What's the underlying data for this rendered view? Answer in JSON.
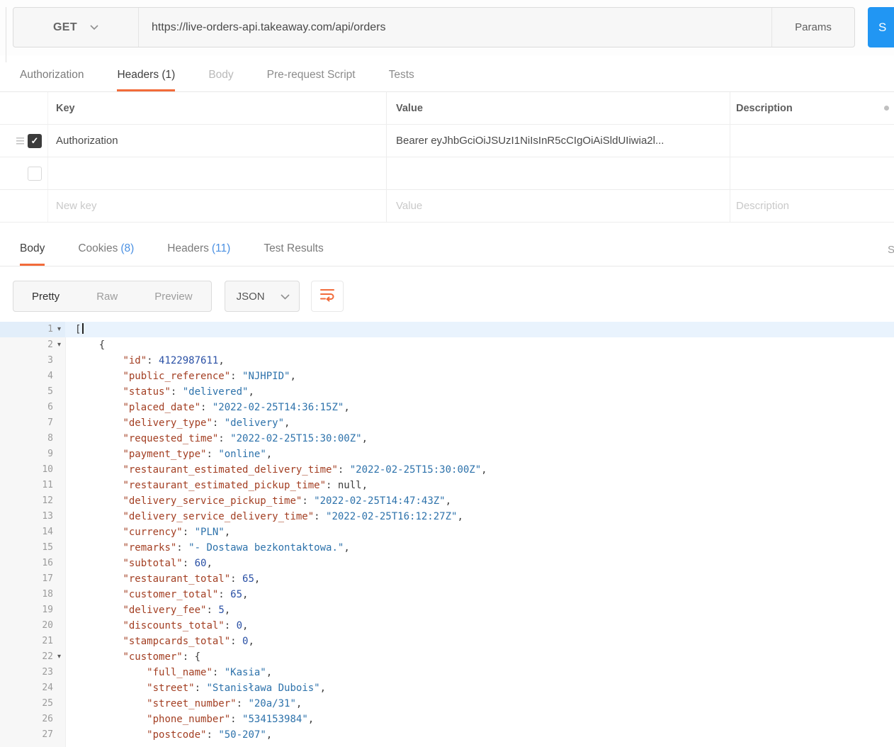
{
  "request": {
    "method": "GET",
    "url": "https://live-orders-api.takeaway.com/api/orders",
    "params_label": "Params",
    "send_label": "S"
  },
  "request_tabs": {
    "authorization": "Authorization",
    "headers": "Headers (1)",
    "body": "Body",
    "prerequest": "Pre-request Script",
    "tests": "Tests"
  },
  "headers_table": {
    "columns": {
      "key": "Key",
      "value": "Value",
      "description": "Description"
    },
    "rows": [
      {
        "key": "Authorization",
        "value": "Bearer eyJhbGciOiJSUzI1NiIsInR5cCIgOiAiSldUIiwia2l...",
        "checked": true
      }
    ],
    "placeholders": {
      "key": "New key",
      "value": "Value",
      "description": "Description"
    }
  },
  "response_tabs": {
    "body": "Body",
    "cookies_label": "Cookies",
    "cookies_count": "(8)",
    "headers_label": "Headers",
    "headers_count": "(11)",
    "test_results": "Test Results",
    "status_cut": "S"
  },
  "response_toolbar": {
    "pretty": "Pretty",
    "raw": "Raw",
    "preview": "Preview",
    "format": "JSON"
  },
  "colors": {
    "accent_orange": "#f26b3a",
    "send_blue": "#2196f3",
    "count_blue": "#4a90e2",
    "json_key": "#a33f23",
    "json_string": "#2d72ab",
    "json_number": "#2a50a5"
  },
  "code": {
    "language": "JSON",
    "lines": [
      {
        "num": 1,
        "fold": true,
        "highlight": true,
        "cursor": true,
        "tokens": [
          [
            "p",
            "["
          ]
        ]
      },
      {
        "num": 2,
        "fold": true,
        "tokens": [
          [
            "p",
            "    {"
          ]
        ]
      },
      {
        "num": 3,
        "tokens": [
          [
            "p",
            "        "
          ],
          [
            "k",
            "\"id\""
          ],
          [
            "p",
            ": "
          ],
          [
            "n",
            "4122987611"
          ],
          [
            "p",
            ","
          ]
        ]
      },
      {
        "num": 4,
        "tokens": [
          [
            "p",
            "        "
          ],
          [
            "k",
            "\"public_reference\""
          ],
          [
            "p",
            ": "
          ],
          [
            "s",
            "\"NJHPID\""
          ],
          [
            "p",
            ","
          ]
        ]
      },
      {
        "num": 5,
        "tokens": [
          [
            "p",
            "        "
          ],
          [
            "k",
            "\"status\""
          ],
          [
            "p",
            ": "
          ],
          [
            "s",
            "\"delivered\""
          ],
          [
            "p",
            ","
          ]
        ]
      },
      {
        "num": 6,
        "tokens": [
          [
            "p",
            "        "
          ],
          [
            "k",
            "\"placed_date\""
          ],
          [
            "p",
            ": "
          ],
          [
            "s",
            "\"2022-02-25T14:36:15Z\""
          ],
          [
            "p",
            ","
          ]
        ]
      },
      {
        "num": 7,
        "tokens": [
          [
            "p",
            "        "
          ],
          [
            "k",
            "\"delivery_type\""
          ],
          [
            "p",
            ": "
          ],
          [
            "s",
            "\"delivery\""
          ],
          [
            "p",
            ","
          ]
        ]
      },
      {
        "num": 8,
        "tokens": [
          [
            "p",
            "        "
          ],
          [
            "k",
            "\"requested_time\""
          ],
          [
            "p",
            ": "
          ],
          [
            "s",
            "\"2022-02-25T15:30:00Z\""
          ],
          [
            "p",
            ","
          ]
        ]
      },
      {
        "num": 9,
        "tokens": [
          [
            "p",
            "        "
          ],
          [
            "k",
            "\"payment_type\""
          ],
          [
            "p",
            ": "
          ],
          [
            "s",
            "\"online\""
          ],
          [
            "p",
            ","
          ]
        ]
      },
      {
        "num": 10,
        "tokens": [
          [
            "p",
            "        "
          ],
          [
            "k",
            "\"restaurant_estimated_delivery_time\""
          ],
          [
            "p",
            ": "
          ],
          [
            "s",
            "\"2022-02-25T15:30:00Z\""
          ],
          [
            "p",
            ","
          ]
        ]
      },
      {
        "num": 11,
        "tokens": [
          [
            "p",
            "        "
          ],
          [
            "k",
            "\"restaurant_estimated_pickup_time\""
          ],
          [
            "p",
            ": "
          ],
          [
            "u",
            "null"
          ],
          [
            "p",
            ","
          ]
        ]
      },
      {
        "num": 12,
        "tokens": [
          [
            "p",
            "        "
          ],
          [
            "k",
            "\"delivery_service_pickup_time\""
          ],
          [
            "p",
            ": "
          ],
          [
            "s",
            "\"2022-02-25T14:47:43Z\""
          ],
          [
            "p",
            ","
          ]
        ]
      },
      {
        "num": 13,
        "tokens": [
          [
            "p",
            "        "
          ],
          [
            "k",
            "\"delivery_service_delivery_time\""
          ],
          [
            "p",
            ": "
          ],
          [
            "s",
            "\"2022-02-25T16:12:27Z\""
          ],
          [
            "p",
            ","
          ]
        ]
      },
      {
        "num": 14,
        "tokens": [
          [
            "p",
            "        "
          ],
          [
            "k",
            "\"currency\""
          ],
          [
            "p",
            ": "
          ],
          [
            "s",
            "\"PLN\""
          ],
          [
            "p",
            ","
          ]
        ]
      },
      {
        "num": 15,
        "tokens": [
          [
            "p",
            "        "
          ],
          [
            "k",
            "\"remarks\""
          ],
          [
            "p",
            ": "
          ],
          [
            "s",
            "\"- Dostawa bezkontaktowa.\""
          ],
          [
            "p",
            ","
          ]
        ]
      },
      {
        "num": 16,
        "tokens": [
          [
            "p",
            "        "
          ],
          [
            "k",
            "\"subtotal\""
          ],
          [
            "p",
            ": "
          ],
          [
            "n",
            "60"
          ],
          [
            "p",
            ","
          ]
        ]
      },
      {
        "num": 17,
        "tokens": [
          [
            "p",
            "        "
          ],
          [
            "k",
            "\"restaurant_total\""
          ],
          [
            "p",
            ": "
          ],
          [
            "n",
            "65"
          ],
          [
            "p",
            ","
          ]
        ]
      },
      {
        "num": 18,
        "tokens": [
          [
            "p",
            "        "
          ],
          [
            "k",
            "\"customer_total\""
          ],
          [
            "p",
            ": "
          ],
          [
            "n",
            "65"
          ],
          [
            "p",
            ","
          ]
        ]
      },
      {
        "num": 19,
        "tokens": [
          [
            "p",
            "        "
          ],
          [
            "k",
            "\"delivery_fee\""
          ],
          [
            "p",
            ": "
          ],
          [
            "n",
            "5"
          ],
          [
            "p",
            ","
          ]
        ]
      },
      {
        "num": 20,
        "tokens": [
          [
            "p",
            "        "
          ],
          [
            "k",
            "\"discounts_total\""
          ],
          [
            "p",
            ": "
          ],
          [
            "n",
            "0"
          ],
          [
            "p",
            ","
          ]
        ]
      },
      {
        "num": 21,
        "tokens": [
          [
            "p",
            "        "
          ],
          [
            "k",
            "\"stampcards_total\""
          ],
          [
            "p",
            ": "
          ],
          [
            "n",
            "0"
          ],
          [
            "p",
            ","
          ]
        ]
      },
      {
        "num": 22,
        "fold": true,
        "tokens": [
          [
            "p",
            "        "
          ],
          [
            "k",
            "\"customer\""
          ],
          [
            "p",
            ": {"
          ]
        ]
      },
      {
        "num": 23,
        "tokens": [
          [
            "p",
            "            "
          ],
          [
            "k",
            "\"full_name\""
          ],
          [
            "p",
            ": "
          ],
          [
            "s",
            "\"Kasia\""
          ],
          [
            "p",
            ","
          ]
        ]
      },
      {
        "num": 24,
        "tokens": [
          [
            "p",
            "            "
          ],
          [
            "k",
            "\"street\""
          ],
          [
            "p",
            ": "
          ],
          [
            "s",
            "\"Stanisława Dubois\""
          ],
          [
            "p",
            ","
          ]
        ]
      },
      {
        "num": 25,
        "tokens": [
          [
            "p",
            "            "
          ],
          [
            "k",
            "\"street_number\""
          ],
          [
            "p",
            ": "
          ],
          [
            "s",
            "\"20a/31\""
          ],
          [
            "p",
            ","
          ]
        ]
      },
      {
        "num": 26,
        "tokens": [
          [
            "p",
            "            "
          ],
          [
            "k",
            "\"phone_number\""
          ],
          [
            "p",
            ": "
          ],
          [
            "s",
            "\"534153984\""
          ],
          [
            "p",
            ","
          ]
        ]
      },
      {
        "num": 27,
        "tokens": [
          [
            "p",
            "            "
          ],
          [
            "k",
            "\"postcode\""
          ],
          [
            "p",
            ": "
          ],
          [
            "s",
            "\"50-207\""
          ],
          [
            "p",
            ","
          ]
        ]
      }
    ]
  }
}
